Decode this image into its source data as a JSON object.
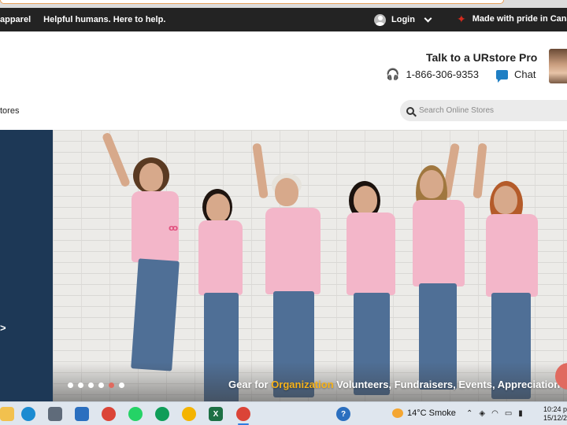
{
  "topbar": {
    "segment_left": "apparel",
    "tagline": "Helpful humans. Here to help.",
    "login_label": "Login",
    "pride_text": "Made with pride in Cana"
  },
  "header": {
    "talk_title": "Talk to a URstore Pro",
    "phone": "1-866-306-9353",
    "chat_label": "Chat",
    "stores_link": "tores",
    "search_placeholder": "Search Online Stores"
  },
  "hero": {
    "side_link": ">",
    "tagline_prefix": "Gear for ",
    "tagline_highlight": "Organization",
    "tagline_rest": " Volunteers, Fundraisers, Events, Appreciation  & m",
    "slide_count": 6,
    "active_slide": 5
  },
  "taskbar": {
    "weather_temp": "14°C Smoke",
    "clock_time": "10:24 p",
    "clock_date": "15/12/2"
  },
  "colors": {
    "topbar_bg": "#232323",
    "accent_blue": "#1f7fc4",
    "side_panel": "#1d3856",
    "highlight": "#f6b21a",
    "maple": "#d52b1e",
    "shirt_pink": "#f3b6c9"
  }
}
